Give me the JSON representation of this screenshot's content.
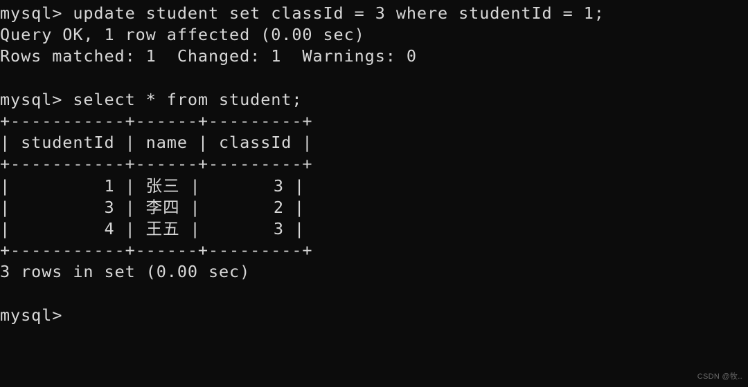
{
  "terminal": {
    "title": "mysql-client-terminal",
    "background_color": "#0c0c0c",
    "text_color": "#d8d8d8",
    "prompt": "mysql>",
    "lines": [
      "mysql> update student set classId = 3 where studentId = 1;",
      "Query OK, 1 row affected (0.00 sec)",
      "Rows matched: 1  Changed: 1  Warnings: 0",
      "",
      "mysql> select * from student;",
      "+-----------+------+---------+",
      "| studentId | name | classId |",
      "+-----------+------+---------+",
      "|         1 | 张三 |       3 |",
      "|         3 | 李四 |       2 |",
      "|         4 | 王五 |       3 |",
      "+-----------+------+---------+",
      "3 rows in set (0.00 sec)",
      "",
      "mysql>"
    ],
    "commands": [
      {
        "index": 0,
        "prompt": "mysql>",
        "sql": "update student set classId = 3 where studentId = 1;",
        "result_status": "Query OK, 1 row affected (0.00 sec)",
        "result_detail": "Rows matched: 1  Changed: 1  Warnings: 0"
      },
      {
        "index": 1,
        "prompt": "mysql>",
        "sql": "select * from student;",
        "result_footer": "3 rows in set (0.00 sec)"
      }
    ],
    "result_table": {
      "columns": [
        "studentId",
        "name",
        "classId"
      ],
      "rows": [
        [
          "1",
          "张三",
          "3"
        ],
        [
          "3",
          "李四",
          "2"
        ],
        [
          "4",
          "王五",
          "3"
        ]
      ],
      "row_count_text": "3 rows in set (0.00 sec)",
      "border_top": "+-----------+------+---------+",
      "border_header": "+-----------+------+---------+",
      "border_bottom": "+-----------+------+---------+"
    }
  },
  "watermark": {
    "text": "CSDN @牧.."
  }
}
